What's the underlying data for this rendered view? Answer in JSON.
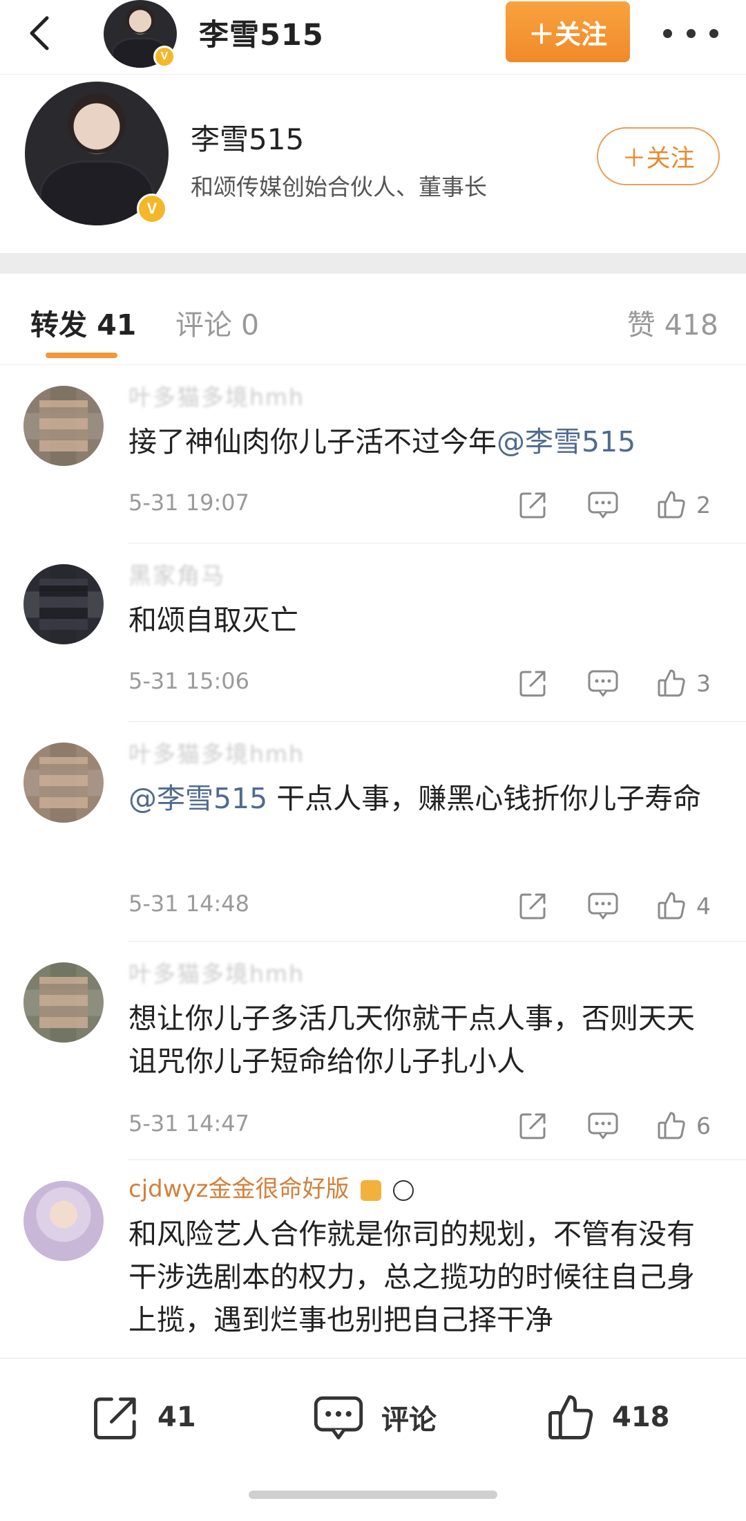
{
  "header": {
    "name": "李雪515",
    "follow_label": "＋关注",
    "verified_badge": "V"
  },
  "profile": {
    "name": "李雪515",
    "description": "和颂传媒创始合伙人、董事长",
    "follow_label": "＋关注"
  },
  "tabs": {
    "repost": "转发 41",
    "comment": "评论 0",
    "like": "赞 418"
  },
  "reposts": [
    {
      "user": "叶多猫多境hmh",
      "text_before": "接了神仙肉你儿子活不过今年",
      "mention": "@李雪515",
      "text_after": "",
      "time": "5-31 19:07",
      "likes": "2"
    },
    {
      "user": "黑家角马",
      "text_before": "和颂自取灭亡",
      "mention": "",
      "text_after": "",
      "time": "5-31 15:06",
      "likes": "3"
    },
    {
      "user": "叶多猫多境hmh",
      "text_before": "",
      "mention": "@李雪515",
      "text_after": " 干点人事，赚黑心钱折你儿子寿命",
      "time": "5-31 14:48",
      "likes": "4"
    },
    {
      "user": "叶多猫多境hmh",
      "text_before": "想让你儿子多活几天你就干点人事，否则天天诅咒你儿子短命给你儿子扎小人",
      "mention": "",
      "text_after": "",
      "time": "5-31 14:47",
      "likes": "6"
    },
    {
      "user": "cjdwyz金金很命好版",
      "text_before": "和风险艺人合作就是你司的规划，不管有没有干涉选剧本的权力，总之揽功的时候往自己身上揽，遇到烂事也别把自己择干净",
      "mention": "",
      "text_after": "",
      "time": "",
      "likes": ""
    }
  ],
  "bottom_bar": {
    "share_count": "41",
    "comment_label": "评论",
    "like_count": "418"
  },
  "colors": {
    "accent": "#f19838",
    "mention": "#4f6b8f",
    "verified": "#f5b72a"
  }
}
